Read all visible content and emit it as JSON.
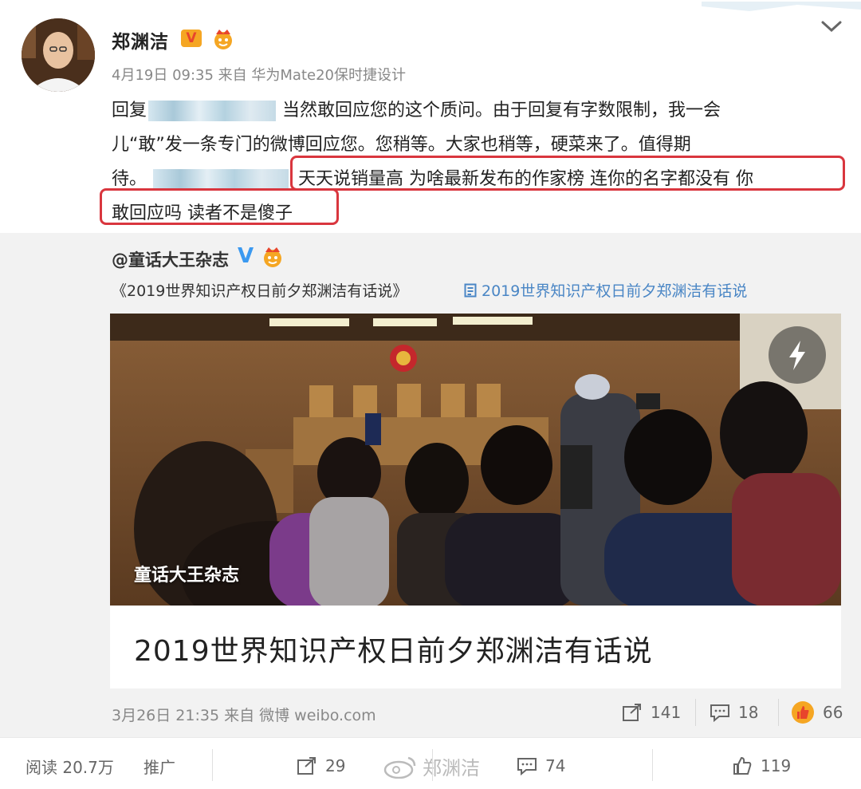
{
  "post": {
    "author": "郑渊洁",
    "v_badge": "V",
    "meta": "4月19日 09:35 来自 华为Mate20保时捷设计",
    "lines": {
      "l1_a": "回复",
      "l1_b": "当然敢回应您的这个质问。由于回复有字数限制，我一会",
      "l2": "儿“敢”发一条专门的微博回应您。您稍等。大家也稍等，硬菜来了。值得期",
      "l3_a": "待。",
      "l3_b": "天天说销量高 为啥最新发布的作家榜 连你的名字都没有 你",
      "l4": "敢回应吗 读者不是傻子"
    }
  },
  "repost": {
    "author": "@童话大王杂志",
    "v_badge": "V",
    "link_text": "《2019世界知识产权日前夕郑渊洁有话说》",
    "link_blue": "2019世界知识产权日前夕郑渊洁有话说",
    "photo_caption": "童话大王杂志",
    "card_title": "2019世界知识产权日前夕郑渊洁有话说",
    "meta": "3月26日 21:35 来自 微博 weibo.com",
    "forwards": "141",
    "comments": "18",
    "likes": "66"
  },
  "bottom": {
    "reads": "阅读 20.7万",
    "promote": "推广",
    "forwards": "29",
    "comments": "74",
    "likes": "119",
    "watermark": "郑渊洁"
  },
  "colors": {
    "highlight_border": "#d9363e",
    "link_blue": "#4a86c5",
    "verified_blue": "#3b99f0",
    "vip_orange": "#f5a623"
  },
  "icons": [
    "chevron-down-icon",
    "share-icon",
    "comment-icon",
    "like-icon",
    "lightning-icon",
    "weibo-logo-icon"
  ]
}
